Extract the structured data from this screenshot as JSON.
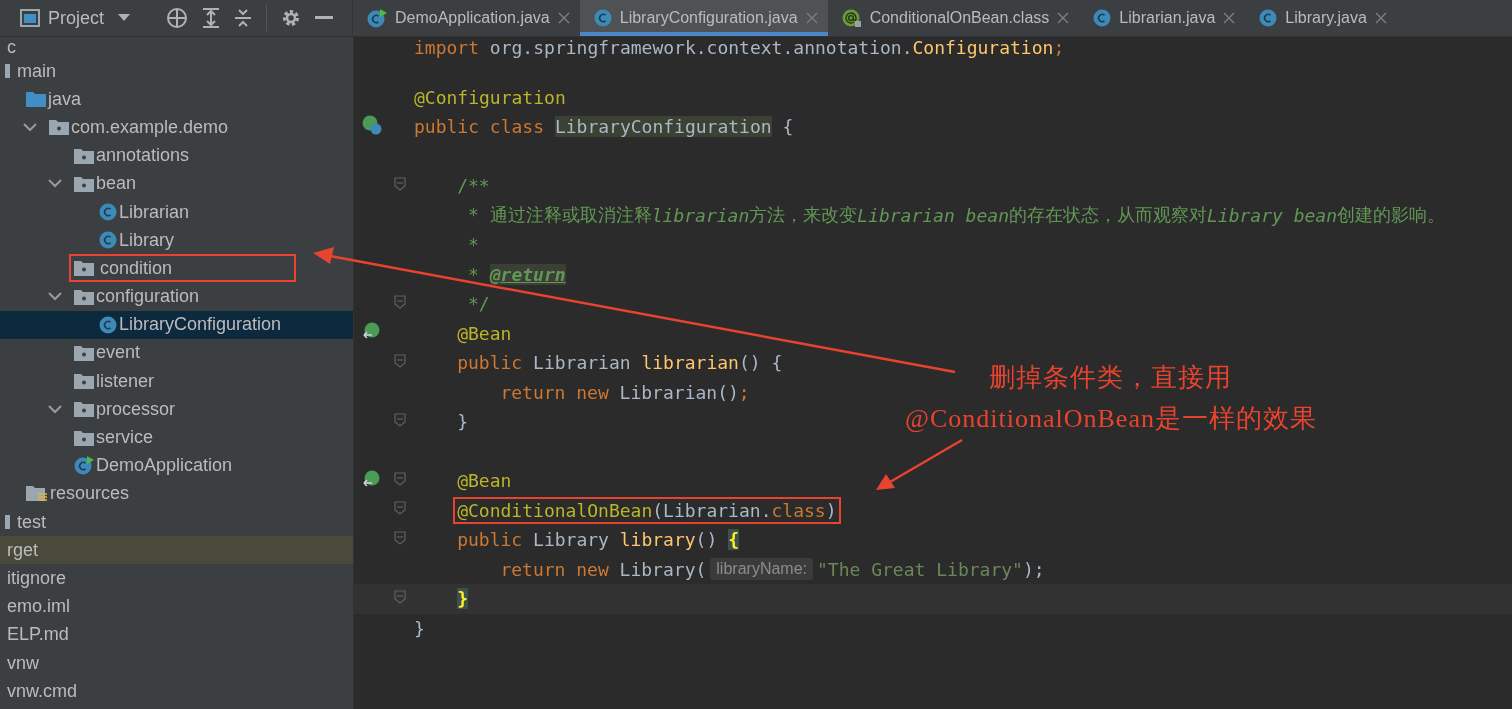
{
  "project_bar": {
    "title": "Project"
  },
  "tabs": [
    {
      "label": "DemoApplication.java",
      "kind": "app",
      "selected": false
    },
    {
      "label": "LibraryConfiguration.java",
      "kind": "class",
      "selected": true
    },
    {
      "label": "ConditionalOnBean.class",
      "kind": "annotation",
      "selected": false
    },
    {
      "label": "Librarian.java",
      "kind": "class",
      "selected": false
    },
    {
      "label": "Library.java",
      "kind": "class",
      "selected": false
    }
  ],
  "tree": [
    {
      "label": "c",
      "selected": false,
      "highlighted": false,
      "children": [
        {
          "label": "main",
          "kind": "folder",
          "selected": false,
          "highlighted": false,
          "children": [
            {
              "label": "java",
              "kind": "source-folder",
              "selected": false,
              "highlighted": false,
              "children": [
                {
                  "label": "com.example.demo",
                  "kind": "package",
                  "expanded": true,
                  "selected": false,
                  "highlighted": false,
                  "children": [
                    {
                      "label": "annotations",
                      "kind": "package",
                      "selected": false,
                      "highlighted": false
                    },
                    {
                      "label": "bean",
                      "kind": "package",
                      "expanded": true,
                      "selected": false,
                      "highlighted": false,
                      "children": [
                        {
                          "label": "Librarian",
                          "kind": "class",
                          "selected": false,
                          "highlighted": false
                        },
                        {
                          "label": "Library",
                          "kind": "class",
                          "selected": false,
                          "highlighted": false
                        }
                      ]
                    },
                    {
                      "label": "condition",
                      "kind": "package",
                      "marked": true,
                      "selected": false,
                      "highlighted": false
                    },
                    {
                      "label": "configuration",
                      "kind": "package",
                      "expanded": true,
                      "selected": false,
                      "highlighted": false,
                      "children": [
                        {
                          "label": "LibraryConfiguration",
                          "kind": "class",
                          "selected": true,
                          "highlighted": false
                        }
                      ]
                    },
                    {
                      "label": "event",
                      "kind": "package",
                      "selected": false,
                      "highlighted": false
                    },
                    {
                      "label": "listener",
                      "kind": "package",
                      "selected": false,
                      "highlighted": false
                    },
                    {
                      "label": "processor",
                      "kind": "package",
                      "expanded": true,
                      "selected": false,
                      "highlighted": false
                    },
                    {
                      "label": "service",
                      "kind": "package",
                      "selected": false,
                      "highlighted": false
                    },
                    {
                      "label": "DemoApplication",
                      "kind": "app",
                      "selected": false,
                      "highlighted": false
                    }
                  ]
                }
              ]
            },
            {
              "label": "resources",
              "kind": "resources-folder",
              "selected": false,
              "highlighted": false
            }
          ]
        },
        {
          "label": "test",
          "kind": "folder",
          "selected": false,
          "highlighted": false
        }
      ]
    },
    {
      "label": "rget",
      "selected": false,
      "highlighted": true
    },
    {
      "label": "itignore",
      "selected": false,
      "highlighted": false
    },
    {
      "label": "emo.iml",
      "selected": false,
      "highlighted": false
    },
    {
      "label": "ELP.md",
      "selected": false,
      "highlighted": false
    },
    {
      "label": "vnw",
      "selected": false,
      "highlighted": false
    },
    {
      "label": "vnw.cmd",
      "selected": false,
      "highlighted": false
    }
  ],
  "code": [
    {
      "kind": "code",
      "tokens": [
        {
          "text": "import ",
          "kind": "keyword"
        },
        {
          "text": "org.springframework.context.annotation.",
          "kind": "plain"
        },
        {
          "text": "Configuration",
          "kind": "method"
        },
        {
          "text": ";",
          "kind": "keyword"
        }
      ]
    },
    {
      "kind": "blank"
    },
    {
      "kind": "code",
      "tokens": [
        {
          "text": "@Configuration",
          "kind": "annotation"
        }
      ]
    },
    {
      "kind": "code",
      "gutter": {
        "kind": "bean-class"
      },
      "tokens": [
        {
          "text": "public class ",
          "kind": "keyword"
        },
        {
          "text": "LibraryConfiguration",
          "kind": "highlight"
        },
        {
          "text": " {",
          "kind": "plain"
        }
      ],
      "children": [
        {
          "kind": "blank"
        },
        {
          "kind": "code",
          "fold": true,
          "tokens": [
            {
              "text": "/**",
              "kind": "comment"
            }
          ]
        },
        {
          "kind": "code",
          "tokens": [
            {
              "text": " * 通过注释或取消注释",
              "kind": "comment"
            },
            {
              "text": "librarian",
              "kind": "comment-italic"
            },
            {
              "text": "方法，来改变",
              "kind": "comment"
            },
            {
              "text": "Librarian bean",
              "kind": "comment-italic"
            },
            {
              "text": "的存在状态，从而观察对",
              "kind": "comment"
            },
            {
              "text": "Library bean",
              "kind": "comment-italic"
            },
            {
              "text": "创建的影响。",
              "kind": "comment"
            }
          ]
        },
        {
          "kind": "code",
          "tokens": [
            {
              "text": " *",
              "kind": "comment"
            }
          ]
        },
        {
          "kind": "code",
          "tokens": [
            {
              "text": " * ",
              "kind": "comment"
            },
            {
              "text": "@return",
              "kind": "doc-tag"
            }
          ]
        },
        {
          "kind": "code",
          "fold": true,
          "tokens": [
            {
              "text": " */",
              "kind": "comment"
            }
          ]
        },
        {
          "kind": "code",
          "gutter": {
            "kind": "bean-method"
          },
          "tokens": [
            {
              "text": "@Bean",
              "kind": "annotation"
            }
          ]
        },
        {
          "kind": "code",
          "fold": true,
          "tokens": [
            {
              "text": "public ",
              "kind": "keyword"
            },
            {
              "text": "Librarian ",
              "kind": "plain"
            },
            {
              "text": "librarian",
              "kind": "method"
            },
            {
              "text": "() {",
              "kind": "plain"
            }
          ],
          "children": [
            {
              "kind": "code",
              "tokens": [
                {
                  "text": "return new ",
                  "kind": "keyword"
                },
                {
                  "text": "Librarian()",
                  "kind": "plain"
                },
                {
                  "text": ";",
                  "kind": "keyword"
                }
              ]
            }
          ]
        },
        {
          "kind": "code",
          "fold": true,
          "tokens": [
            {
              "text": "}",
              "kind": "plain"
            }
          ]
        },
        {
          "kind": "blank"
        },
        {
          "kind": "code",
          "gutter": {
            "kind": "bean-method"
          },
          "fold": true,
          "tokens": [
            {
              "text": "@Bean",
              "kind": "annotation"
            }
          ]
        },
        {
          "kind": "code",
          "fold": true,
          "boxed": true,
          "tokens": [
            {
              "text": "@ConditionalOnBean",
              "kind": "annotation"
            },
            {
              "text": "(Librarian.",
              "kind": "plain"
            },
            {
              "text": "class",
              "kind": "keyword"
            },
            {
              "text": ")",
              "kind": "plain"
            }
          ]
        },
        {
          "kind": "code",
          "fold": true,
          "tokens": [
            {
              "text": "public ",
              "kind": "keyword"
            },
            {
              "text": "Library ",
              "kind": "plain"
            },
            {
              "text": "library",
              "kind": "method"
            },
            {
              "text": "() ",
              "kind": "plain"
            },
            {
              "text": "{",
              "kind": "brace"
            }
          ],
          "children": [
            {
              "kind": "code",
              "tokens": [
                {
                  "text": "return new ",
                  "kind": "keyword"
                },
                {
                  "text": "Library(",
                  "kind": "plain"
                },
                {
                  "text": "libraryName:",
                  "kind": "hint"
                },
                {
                  "text": "\"The Great Library\"",
                  "kind": "string"
                },
                {
                  "text": ");",
                  "kind": "plain"
                }
              ]
            }
          ]
        },
        {
          "kind": "code",
          "fold": true,
          "current": true,
          "tokens": [
            {
              "text": "}",
              "kind": "brace"
            }
          ]
        }
      ]
    },
    {
      "kind": "code",
      "tokens": [
        {
          "text": "}",
          "kind": "plain"
        }
      ]
    }
  ],
  "note": {
    "lines": [
      "删掉条件类，直接用",
      "@ConditionalOnBean是一样的效果"
    ]
  }
}
